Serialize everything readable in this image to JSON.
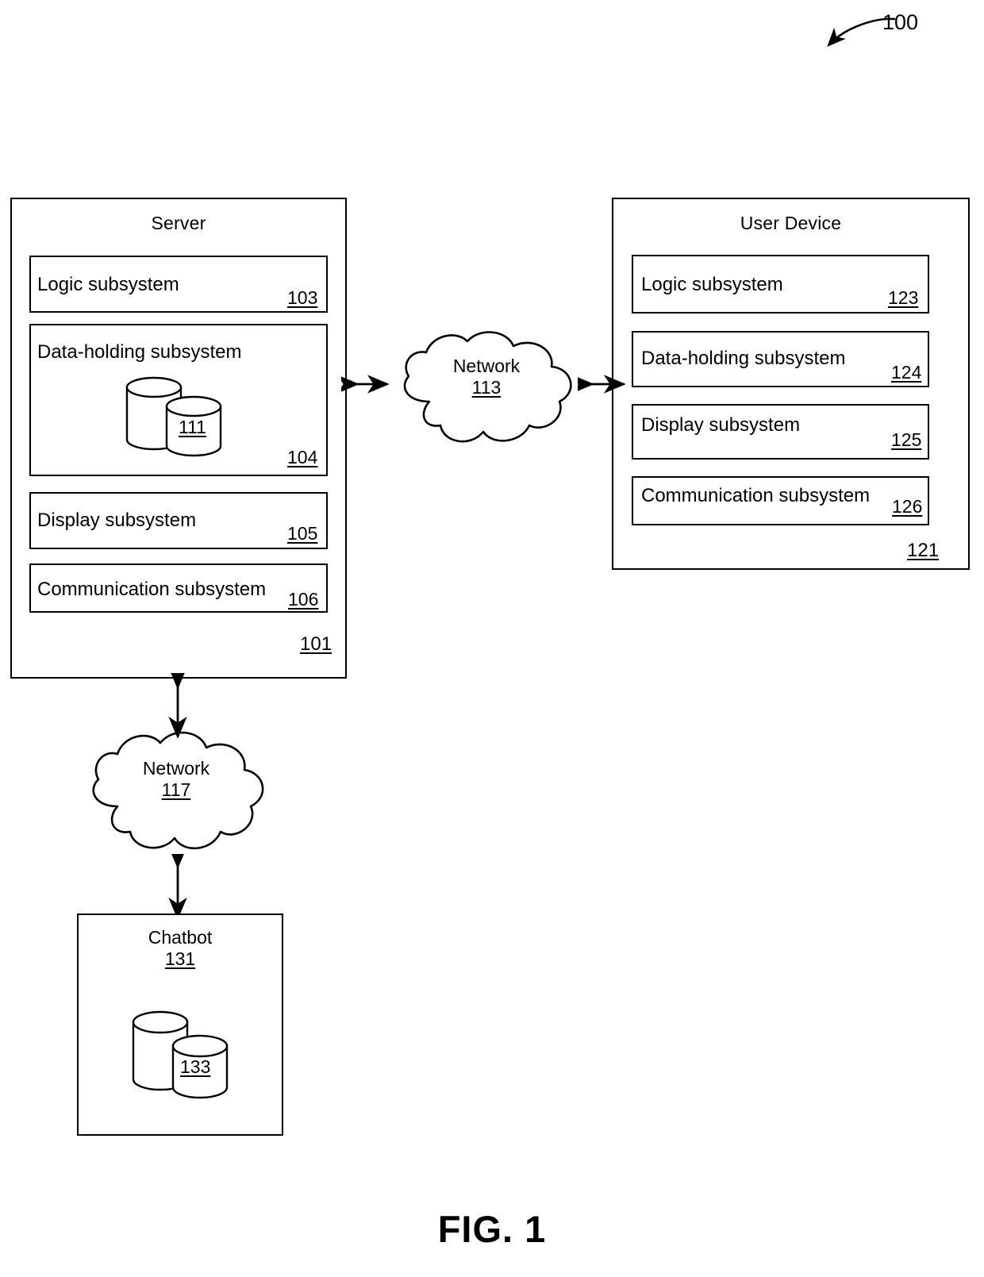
{
  "figure": {
    "caption": "FIG. 1",
    "top_reference": "100"
  },
  "server": {
    "title": "Server",
    "reference": "101",
    "subsystems": [
      {
        "label": "Logic subsystem",
        "reference": "103"
      },
      {
        "label": "Data-holding subsystem",
        "reference": "104",
        "database_reference": "111"
      },
      {
        "label": "Display subsystem",
        "reference": "105"
      },
      {
        "label": "Communication subsystem",
        "reference": "106"
      }
    ]
  },
  "user_device": {
    "title": "User Device",
    "reference": "121",
    "subsystems": [
      {
        "label": "Logic subsystem",
        "reference": "123"
      },
      {
        "label": "Data-holding subsystem",
        "reference": "124"
      },
      {
        "label": "Display subsystem",
        "reference": "125"
      },
      {
        "label": "Communication subsystem",
        "reference": "126"
      }
    ]
  },
  "network_middle": {
    "label": "Network",
    "reference": "113"
  },
  "network_lower": {
    "label": "Network",
    "reference": "117"
  },
  "chatbot": {
    "title": "Chatbot",
    "reference": "131",
    "database_reference": "133"
  },
  "connectors": [
    {
      "name": "server-to-network-113",
      "direction": "bidirectional"
    },
    {
      "name": "network-113-to-user-device",
      "direction": "bidirectional"
    },
    {
      "name": "server-to-network-117",
      "direction": "bidirectional"
    },
    {
      "name": "network-117-to-chatbot",
      "direction": "bidirectional"
    }
  ],
  "colors": {
    "stroke": "#000000",
    "background": "#ffffff"
  }
}
